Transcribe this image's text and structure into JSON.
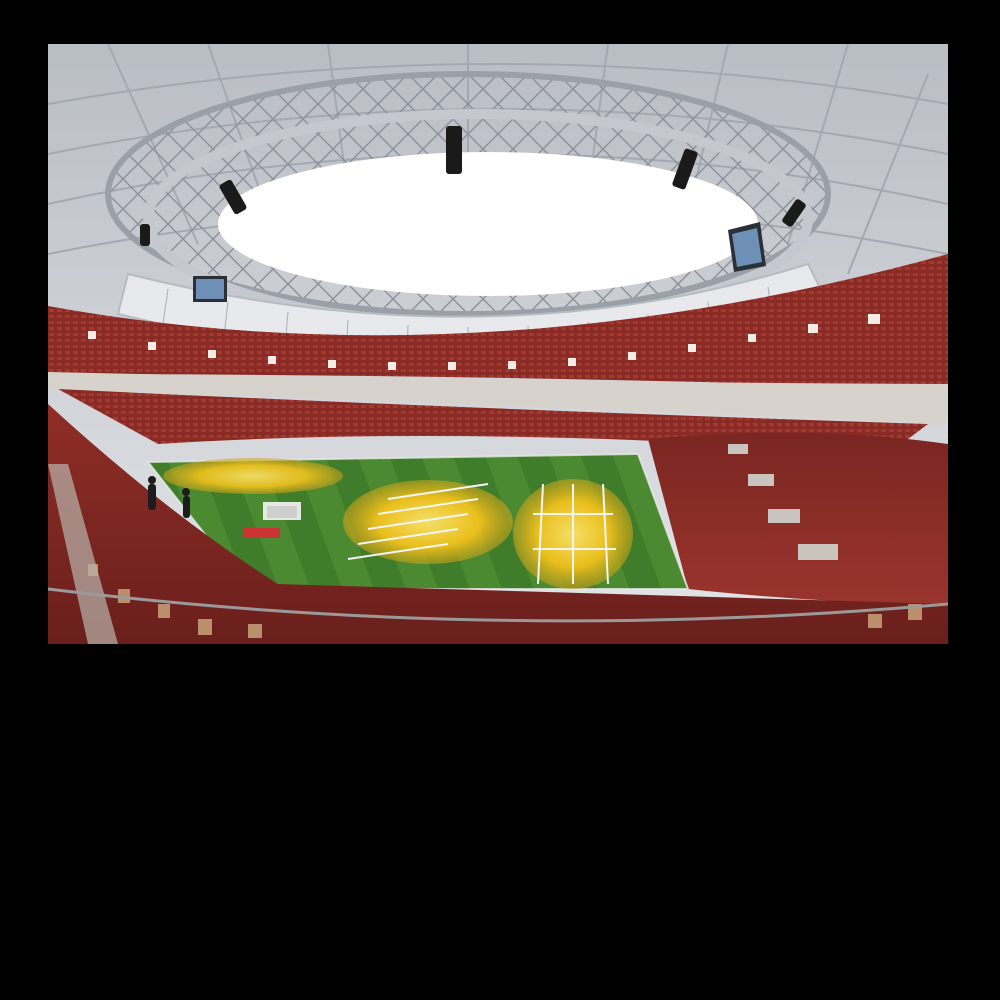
{
  "image": {
    "subject": "stadium-interior-fisheye",
    "colors": {
      "background": "#000000",
      "sky": "#ffffff",
      "roof_steel": "#d6d8dc",
      "roof_shadow": "#8d929b",
      "seats_red": "#8e2a25",
      "seats_dark": "#5a1c1a",
      "seats_tan": "#c9a27a",
      "pitch_green": "#3f7d2a",
      "pitch_light": "#6aa33a",
      "grow_light_yellow": "#f2c21b",
      "screen_blue": "#6e8fb6"
    },
    "elements": [
      "roof-truss-ring",
      "open-sky",
      "video-screen-left",
      "video-screen-right",
      "upper-tier-seats",
      "lower-tier-seats",
      "pitch",
      "grow-light-rigs",
      "goal"
    ]
  }
}
